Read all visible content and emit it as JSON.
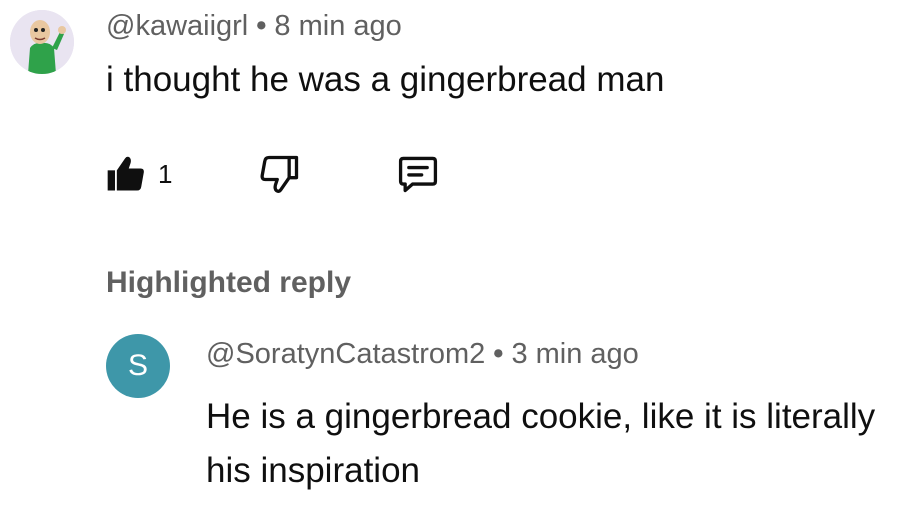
{
  "comment": {
    "author": "@kawaiigrl",
    "separator": "•",
    "time": "8 min ago",
    "text": "i thought he was a gingerbread man",
    "like_count": "1",
    "icons": {
      "like": "thumbs-up-filled-icon",
      "dislike": "thumbs-down-outline-icon",
      "reply": "comment-bubble-icon"
    }
  },
  "highlighted_label": "Highlighted reply",
  "reply": {
    "avatar_letter": "S",
    "author": "@SoratynCatastrom2",
    "separator": "•",
    "time": "3 min ago",
    "text": "He is a gingerbread cookie, like it is literally his inspiration"
  },
  "colors": {
    "text_primary": "#0f0f0f",
    "text_secondary": "#606060",
    "reply_avatar": "#3e97a9",
    "main_avatar_bg": "#e9e4f1"
  }
}
